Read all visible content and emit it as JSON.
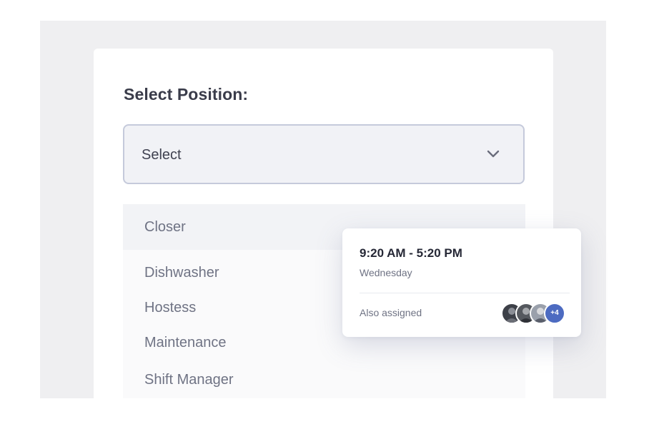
{
  "card": {
    "title": "Select Position:"
  },
  "select": {
    "value": "Select",
    "icon": "chevron-down-icon"
  },
  "dropdown": {
    "options": [
      "Closer",
      "Dishwasher",
      "Hostess",
      "Maintenance",
      "Shift Manager"
    ],
    "highlighted": "Closer"
  },
  "shift_popup": {
    "time": "9:20 AM - 5:20 PM",
    "day": "Wednesday",
    "assigned_label": "Also assigned",
    "extra_count": "+4"
  },
  "colors": {
    "background": "#efeff1",
    "card": "#ffffff",
    "select_border": "#c5cadb",
    "select_fill": "#f1f2f6",
    "accent": "#4d6bc1",
    "text_dark": "#3a3c4a",
    "text_muted": "#6f7384"
  }
}
